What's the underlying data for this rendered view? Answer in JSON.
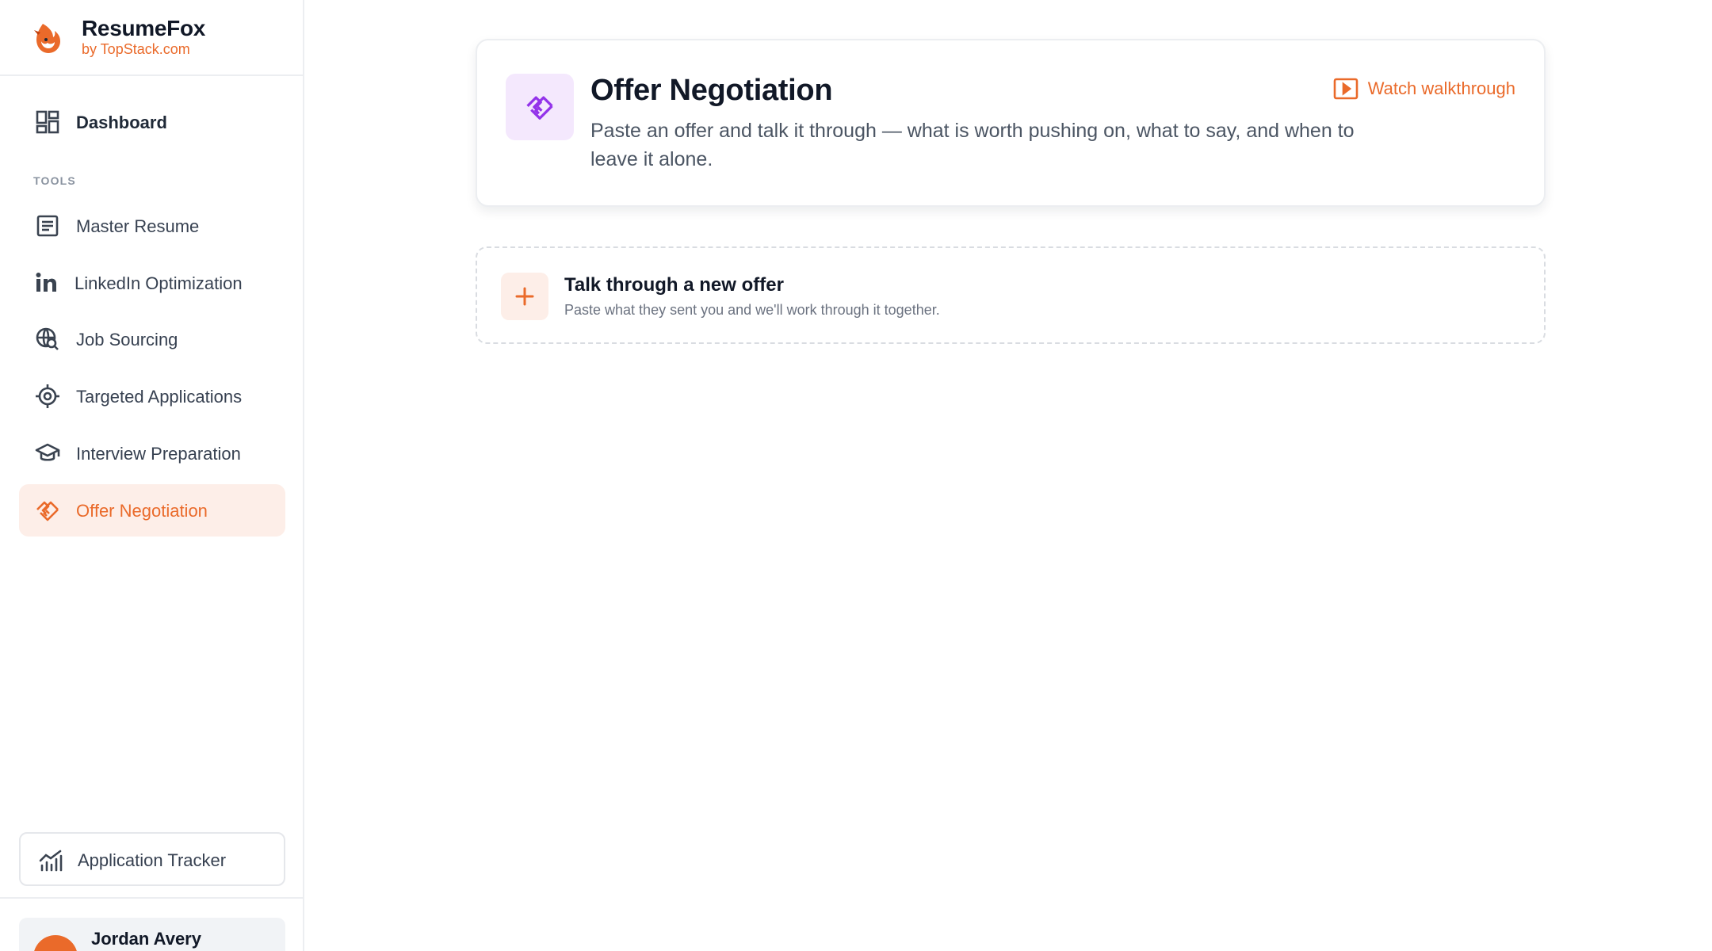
{
  "brand": {
    "name": "ResumeFox",
    "tagline": "by TopStack.com"
  },
  "sidebar": {
    "dashboard": {
      "label": "Dashboard",
      "icon": "dashboard-grid-icon"
    },
    "section_label": "TOOLS",
    "items": [
      {
        "label": "Master Resume",
        "icon": "document-icon"
      },
      {
        "label": "LinkedIn Optimization",
        "icon": "linkedin-icon"
      },
      {
        "label": "Job Sourcing",
        "icon": "globe-search-icon"
      },
      {
        "label": "Targeted Applications",
        "icon": "target-icon"
      },
      {
        "label": "Interview Preparation",
        "icon": "graduation-cap-icon"
      },
      {
        "label": "Offer Negotiation",
        "icon": "handshake-icon",
        "active": true
      }
    ],
    "tracker": {
      "label": "Application Tracker",
      "icon": "chart-icon"
    }
  },
  "user": {
    "name": "Jordan Avery"
  },
  "header": {
    "title": "Offer Negotiation",
    "description": "Paste an offer and talk it through — what is worth pushing on, what to say, and when to leave it alone.",
    "walkthrough_label": "Watch walkthrough"
  },
  "new_offer": {
    "title": "Talk through a new offer",
    "subtitle": "Paste what they sent you and we'll work through it together."
  },
  "colors": {
    "accent": "#ea6a2a",
    "active_bg": "#fdeee8",
    "feature_icon_bg": "#f4e8fd",
    "feature_icon_fg": "#9333ea"
  }
}
